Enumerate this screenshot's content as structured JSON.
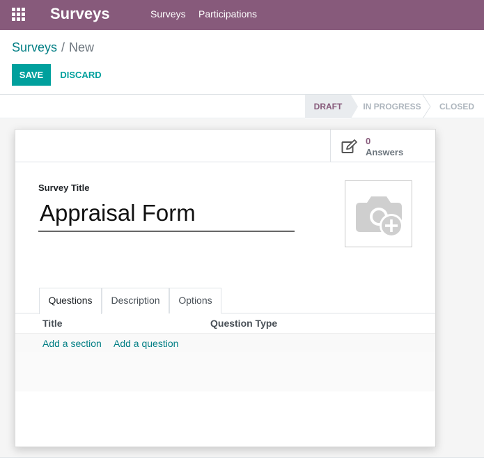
{
  "navbar": {
    "brand": "Surveys",
    "links": [
      "Surveys",
      "Participations"
    ],
    "bg_color": "#875A7B"
  },
  "breadcrumb": {
    "parent": "Surveys",
    "separator": "/",
    "current": "New"
  },
  "buttons": {
    "save": "SAVE",
    "discard": "DISCARD"
  },
  "statusbar": {
    "stages": [
      "DRAFT",
      "IN PROGRESS",
      "CLOSED"
    ],
    "active": "DRAFT"
  },
  "stat_button": {
    "icon": "edit-icon",
    "value": "0",
    "label": "Answers"
  },
  "form": {
    "title_label": "Survey Title",
    "title_value": "Appraisal Form",
    "image_icon": "camera-plus-icon"
  },
  "tabs": [
    "Questions",
    "Description",
    "Options"
  ],
  "active_tab": "Questions",
  "questions_list": {
    "columns": [
      "Title",
      "Question Type"
    ],
    "add_section": "Add a section",
    "add_question": "Add a question"
  },
  "colors": {
    "primary": "#875A7B",
    "accent": "#00A09D",
    "link": "#017e84"
  }
}
